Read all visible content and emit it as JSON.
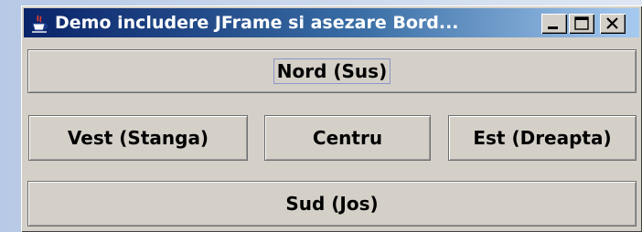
{
  "window": {
    "title": "Demo includere JFrame si asezare Bord...",
    "icon": "java-cup-icon",
    "controls": {
      "minimize": "minimize-icon",
      "maximize": "maximize-icon",
      "close": "close-icon"
    }
  },
  "layout": {
    "north_label": "Nord (Sus)",
    "west_label": "Vest (Stanga)",
    "center_label": "Centru",
    "east_label": "Est (Dreapta)",
    "south_label": "Sud (Jos)"
  },
  "colors": {
    "titlebar_start": "#0a246a",
    "titlebar_end": "#a6caf0",
    "face": "#d4d0c8"
  }
}
